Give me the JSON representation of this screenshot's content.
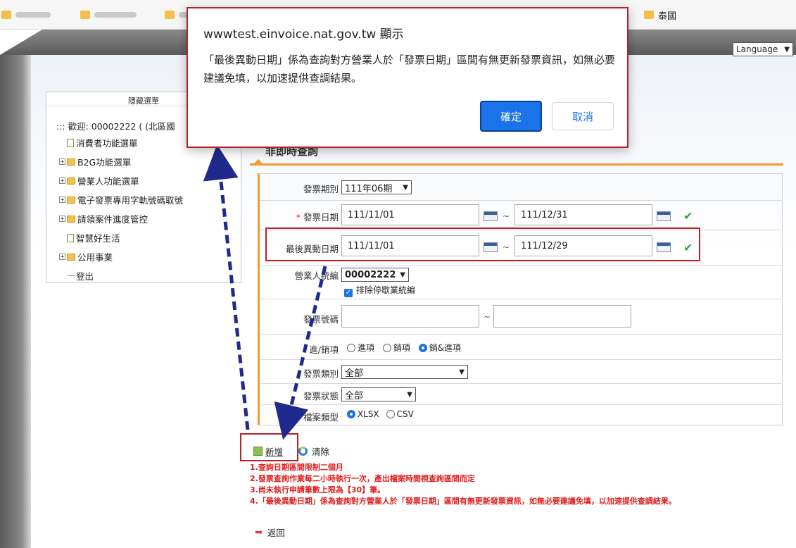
{
  "bookmarks": {
    "visible_folder": "泰國"
  },
  "language_select": "Language",
  "menu": {
    "header": "隱藏選單",
    "welcome": "::: 歡迎: 00002222 ( (北區國",
    "items": [
      {
        "label": "消費者功能選單",
        "type": "doc"
      },
      {
        "label": "B2G功能選單",
        "type": "folder"
      },
      {
        "label": "營業人功能選單",
        "type": "folder"
      },
      {
        "label": "電子發票專用字軌號碼取號",
        "type": "folder"
      },
      {
        "label": "請領案件進度管控",
        "type": "folder"
      },
      {
        "label": "智慧好生活",
        "type": "doc"
      },
      {
        "label": "公用事業",
        "type": "folder"
      },
      {
        "label": "登出",
        "type": "leaf"
      }
    ]
  },
  "section_title": "非即時查詢",
  "form": {
    "period": {
      "label": "發票期別",
      "value": "111年06期"
    },
    "invoice_date": {
      "required_mark": "*",
      "label": "發票日期",
      "from": "111/11/01",
      "to": "111/12/31"
    },
    "last_change_date": {
      "label": "最後異動日期",
      "from": "111/11/01",
      "to": "111/12/29"
    },
    "business_id": {
      "label": "營業人統編",
      "value": "00002222",
      "exclude_label": "排除停歇業統編"
    },
    "invoice_number": {
      "label": "發票號碼",
      "from": "",
      "to": ""
    },
    "direction": {
      "label": "進/銷項",
      "options": [
        "進項",
        "銷項",
        "銷&進項"
      ],
      "selected": "銷&進項"
    },
    "invoice_type": {
      "label": "發票類別",
      "value": "全部"
    },
    "invoice_status": {
      "label": "發票狀態",
      "value": "全部"
    },
    "file_type": {
      "label": "檔案類型",
      "options": [
        "XLSX",
        "CSV"
      ],
      "selected": "XLSX"
    },
    "tilde": "~"
  },
  "actions": {
    "add": "新增",
    "clear": "清除",
    "back": "返回"
  },
  "notes": [
    "1.查詢日期區間限制二個月",
    "2.發票查詢作業每二小時執行一次，產出檔案時間視查詢區間而定",
    "3.尚未執行申請筆數上限為【30】筆。",
    "4.「最後異動日期」係為查詢對方營業人於「發票日期」區間有無更新發票資訊，如無必要建議免填，以加速提供查調結果。"
  ],
  "dialog": {
    "title": "wwwtest.einvoice.nat.gov.tw 顯示",
    "message": "「最後異動日期」係為查詢對方營業人於「發票日期」區間有無更新發票資訊，如無必要建議免填，以加速提供查調結果。",
    "ok": "確定",
    "cancel": "取消"
  },
  "colors": {
    "accent": "#1a73e8",
    "highlight": "#b8202a",
    "section_line": "#f39c2b",
    "note_text": "#e01e1e",
    "arrow": "#1f2a8c"
  }
}
